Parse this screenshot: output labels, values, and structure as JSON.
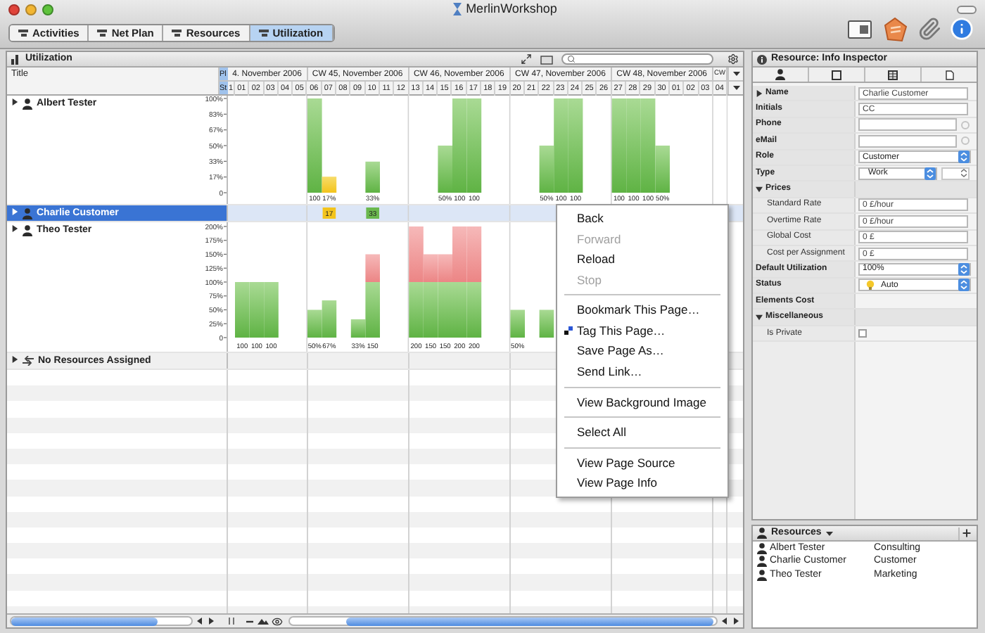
{
  "window": {
    "title": "MerlinWorkshop"
  },
  "toolbar": {
    "tabs": [
      {
        "label": "Activities",
        "selected": false
      },
      {
        "label": "Net Plan",
        "selected": false
      },
      {
        "label": "Resources",
        "selected": false
      },
      {
        "label": "Utilization",
        "selected": true
      }
    ]
  },
  "utilization": {
    "title": "Utilization",
    "header": {
      "title_column": "Title",
      "corner_top": "Pl",
      "corner_bottom": "St",
      "weeks": [
        {
          "label": "4. November 2006",
          "days": [
            "1",
            "01",
            "02",
            "03",
            "04",
            "05"
          ]
        },
        {
          "label": "CW 45, November 2006",
          "days": [
            "06",
            "07",
            "08",
            "09",
            "10",
            "11",
            "12"
          ]
        },
        {
          "label": "CW 46, November 2006",
          "days": [
            "13",
            "14",
            "15",
            "16",
            "17",
            "18",
            "19"
          ]
        },
        {
          "label": "CW 47, November 2006",
          "days": [
            "20",
            "21",
            "22",
            "23",
            "24",
            "25",
            "26"
          ]
        },
        {
          "label": "CW 48, November 2006",
          "days": [
            "27",
            "28",
            "29",
            "30",
            "01",
            "02",
            "03"
          ]
        },
        {
          "label": "CW",
          "days": [
            "04"
          ]
        }
      ]
    },
    "rows": [
      {
        "kind": "resource",
        "name": "Albert Tester",
        "expanded": false,
        "selected": false,
        "y_axis_labels": [
          "100%",
          "83%",
          "67%",
          "50%",
          "33%",
          "17%",
          "0"
        ],
        "days": [
          {
            "kind": "empty"
          },
          {
            "kind": "empty"
          },
          {
            "kind": "empty"
          },
          {
            "kind": "empty"
          },
          {
            "kind": "empty"
          },
          {
            "kind": "empty"
          },
          {
            "kind": "bar",
            "segments": [
              {
                "kind": "normal",
                "level": 1
              }
            ],
            "label": "100"
          },
          {
            "kind": "bar",
            "segments": [
              {
                "kind": "low",
                "level": 0.17
              }
            ],
            "label": "17%"
          },
          {
            "kind": "empty"
          },
          {
            "kind": "empty"
          },
          {
            "kind": "bar",
            "segments": [
              {
                "kind": "normal",
                "level": 0.33
              }
            ],
            "label": "33%"
          },
          {
            "kind": "empty"
          },
          {
            "kind": "empty"
          },
          {
            "kind": "empty"
          },
          {
            "kind": "empty"
          },
          {
            "kind": "bar",
            "segments": [
              {
                "kind": "normal",
                "level": 0.5
              }
            ],
            "label": "50%"
          },
          {
            "kind": "bar",
            "segments": [
              {
                "kind": "normal",
                "level": 1
              }
            ],
            "label": "100"
          },
          {
            "kind": "bar",
            "segments": [
              {
                "kind": "normal",
                "level": 1
              }
            ],
            "label": "100"
          },
          {
            "kind": "empty"
          },
          {
            "kind": "empty"
          },
          {
            "kind": "empty"
          },
          {
            "kind": "empty"
          },
          {
            "kind": "bar",
            "segments": [
              {
                "kind": "normal",
                "level": 0.5
              }
            ],
            "label": "50%"
          },
          {
            "kind": "bar",
            "segments": [
              {
                "kind": "normal",
                "level": 1
              }
            ],
            "label": "100"
          },
          {
            "kind": "bar",
            "segments": [
              {
                "kind": "normal",
                "level": 1
              }
            ],
            "label": "100"
          },
          {
            "kind": "empty"
          },
          {
            "kind": "empty"
          },
          {
            "kind": "bar",
            "segments": [
              {
                "kind": "normal",
                "level": 1
              }
            ],
            "label": "100"
          },
          {
            "kind": "bar",
            "segments": [
              {
                "kind": "normal",
                "level": 1
              }
            ],
            "label": "100"
          },
          {
            "kind": "bar",
            "segments": [
              {
                "kind": "normal",
                "level": 1
              }
            ],
            "label": "100"
          },
          {
            "kind": "bar",
            "segments": [
              {
                "kind": "normal",
                "level": 0.5
              }
            ],
            "label": "50%"
          },
          {
            "kind": "empty"
          },
          {
            "kind": "empty"
          },
          {
            "kind": "empty"
          },
          {
            "kind": "empty"
          }
        ]
      },
      {
        "kind": "resource",
        "name": "Charlie Customer",
        "expanded": false,
        "selected": true,
        "cells": [
          {
            "kind": "empty"
          },
          {
            "kind": "empty"
          },
          {
            "kind": "empty"
          },
          {
            "kind": "empty"
          },
          {
            "kind": "empty"
          },
          {
            "kind": "empty"
          },
          {
            "kind": "empty"
          },
          {
            "kind": "badge",
            "text": "17",
            "color": "#f3c41c"
          },
          {
            "kind": "empty"
          },
          {
            "kind": "empty"
          },
          {
            "kind": "badge",
            "text": "33",
            "color": "#6ab84e"
          },
          {
            "kind": "empty"
          },
          {
            "kind": "empty"
          },
          {
            "kind": "empty"
          },
          {
            "kind": "empty"
          },
          {
            "kind": "empty"
          },
          {
            "kind": "empty"
          },
          {
            "kind": "empty"
          },
          {
            "kind": "empty"
          },
          {
            "kind": "empty"
          },
          {
            "kind": "empty"
          },
          {
            "kind": "empty"
          },
          {
            "kind": "empty"
          },
          {
            "kind": "empty"
          },
          {
            "kind": "empty"
          },
          {
            "kind": "empty"
          },
          {
            "kind": "empty"
          },
          {
            "kind": "empty"
          },
          {
            "kind": "empty"
          },
          {
            "kind": "empty"
          },
          {
            "kind": "empty"
          },
          {
            "kind": "empty"
          },
          {
            "kind": "empty"
          },
          {
            "kind": "empty"
          },
          {
            "kind": "empty"
          }
        ]
      },
      {
        "kind": "resource",
        "name": "Theo Tester",
        "expanded": false,
        "selected": false,
        "y_axis_labels": [
          "200%",
          "175%",
          "150%",
          "125%",
          "100%",
          "75%",
          "50%",
          "25%",
          "0"
        ],
        "days": [
          {
            "kind": "empty"
          },
          {
            "kind": "bar",
            "segments": [
              {
                "kind": "normal",
                "level": 0.5
              }
            ],
            "label": "100"
          },
          {
            "kind": "bar",
            "segments": [
              {
                "kind": "normal",
                "level": 0.5
              }
            ],
            "label": "100"
          },
          {
            "kind": "bar",
            "segments": [
              {
                "kind": "normal",
                "level": 0.5
              }
            ],
            "label": "100"
          },
          {
            "kind": "empty"
          },
          {
            "kind": "empty"
          },
          {
            "kind": "bar",
            "segments": [
              {
                "kind": "normal",
                "level": 0.25
              }
            ],
            "label": "50%"
          },
          {
            "kind": "bar",
            "segments": [
              {
                "kind": "normal",
                "level": 0.335
              }
            ],
            "label": "67%"
          },
          {
            "kind": "empty"
          },
          {
            "kind": "bar",
            "segments": [
              {
                "kind": "normal",
                "level": 0.165
              }
            ],
            "label": "33%"
          },
          {
            "kind": "bar",
            "segments": [
              {
                "kind": "normal",
                "level": 0.5
              },
              {
                "kind": "over",
                "level": 0.25
              }
            ],
            "label": "150"
          },
          {
            "kind": "empty"
          },
          {
            "kind": "empty"
          },
          {
            "kind": "bar",
            "segments": [
              {
                "kind": "normal",
                "level": 0.5
              },
              {
                "kind": "over",
                "level": 0.5
              }
            ],
            "label": "200"
          },
          {
            "kind": "bar",
            "segments": [
              {
                "kind": "normal",
                "level": 0.5
              },
              {
                "kind": "over",
                "level": 0.25
              }
            ],
            "label": "150"
          },
          {
            "kind": "bar",
            "segments": [
              {
                "kind": "normal",
                "level": 0.5
              },
              {
                "kind": "over",
                "level": 0.25
              }
            ],
            "label": "150"
          },
          {
            "kind": "bar",
            "segments": [
              {
                "kind": "normal",
                "level": 0.5
              },
              {
                "kind": "over",
                "level": 0.5
              }
            ],
            "label": "200"
          },
          {
            "kind": "bar",
            "segments": [
              {
                "kind": "normal",
                "level": 0.5
              },
              {
                "kind": "over",
                "level": 0.5
              }
            ],
            "label": "200"
          },
          {
            "kind": "empty"
          },
          {
            "kind": "empty"
          },
          {
            "kind": "bar",
            "segments": [
              {
                "kind": "normal",
                "level": 0.25
              }
            ],
            "label": "50%"
          },
          {
            "kind": "empty"
          },
          {
            "kind": "bar",
            "segments": [
              {
                "kind": "normal",
                "level": 0.25
              }
            ]
          },
          {
            "kind": "empty"
          },
          {
            "kind": "empty"
          },
          {
            "kind": "empty"
          },
          {
            "kind": "empty"
          },
          {
            "kind": "empty"
          },
          {
            "kind": "empty"
          },
          {
            "kind": "empty"
          },
          {
            "kind": "empty"
          },
          {
            "kind": "empty"
          },
          {
            "kind": "empty"
          },
          {
            "kind": "empty"
          },
          {
            "kind": "empty"
          }
        ]
      },
      {
        "kind": "unassigned",
        "name": "No Resources Assigned",
        "expanded": false,
        "selected": false
      }
    ]
  },
  "context_menu": {
    "items": [
      {
        "kind": "item",
        "label": "Back",
        "disabled": false
      },
      {
        "kind": "item",
        "label": "Forward",
        "disabled": true
      },
      {
        "kind": "item",
        "label": "Reload",
        "disabled": false
      },
      {
        "kind": "item",
        "label": "Stop",
        "disabled": true
      },
      {
        "kind": "separator"
      },
      {
        "kind": "item",
        "label": "Bookmark This Page…",
        "disabled": false
      },
      {
        "kind": "icon_item",
        "label": "Tag This Page…",
        "disabled": false
      },
      {
        "kind": "item",
        "label": "Save Page As…",
        "disabled": false
      },
      {
        "kind": "item",
        "label": "Send Link…",
        "disabled": false
      },
      {
        "kind": "separator"
      },
      {
        "kind": "item",
        "label": "View Background Image",
        "disabled": false
      },
      {
        "kind": "separator"
      },
      {
        "kind": "item",
        "label": "Select All",
        "disabled": false
      },
      {
        "kind": "separator"
      },
      {
        "kind": "item",
        "label": "View Page Source",
        "disabled": false
      },
      {
        "kind": "item",
        "label": "View Page Info",
        "disabled": false
      }
    ]
  },
  "inspector": {
    "title": "Resource: Info Inspector",
    "properties": [
      {
        "kind": "field",
        "label": "Name",
        "expanded": false,
        "value": "Charlie Customer"
      },
      {
        "kind": "field",
        "label": "Initials",
        "value": "CC"
      },
      {
        "kind": "link_field",
        "label": "Phone"
      },
      {
        "kind": "link_field",
        "label": "eMail"
      },
      {
        "kind": "dropdown",
        "label": "Role",
        "value": "Customer"
      },
      {
        "kind": "dropdown_pair",
        "label": "Type",
        "value": "Work"
      },
      {
        "kind": "group",
        "label": "Prices",
        "expanded": true,
        "children": [
          {
            "kind": "field",
            "label": "Standard Rate",
            "value": "0 £/hour"
          },
          {
            "kind": "field",
            "label": "Overtime Rate",
            "value": "0 £/hour"
          },
          {
            "kind": "field",
            "label": "Global Cost",
            "value": "0 £"
          },
          {
            "kind": "field",
            "label": "Cost per Assignment",
            "value": "0 £"
          }
        ]
      },
      {
        "kind": "dropdown",
        "label": "Default Utilization",
        "value": "100%"
      },
      {
        "kind": "status_dropdown",
        "label": "Status",
        "value": "Auto"
      },
      {
        "kind": "label",
        "label": "Elements Cost"
      },
      {
        "kind": "group",
        "label": "Miscellaneous",
        "expanded": true,
        "children": [
          {
            "kind": "checkbox",
            "label": "Is Private",
            "checked": false
          }
        ]
      }
    ]
  },
  "resources_panel": {
    "title": "Resources",
    "rows": [
      {
        "name": "Albert Tester",
        "role": "Consulting"
      },
      {
        "name": "Charlie Customer",
        "role": "Customer"
      },
      {
        "name": "Theo Tester",
        "role": "Marketing"
      }
    ]
  }
}
